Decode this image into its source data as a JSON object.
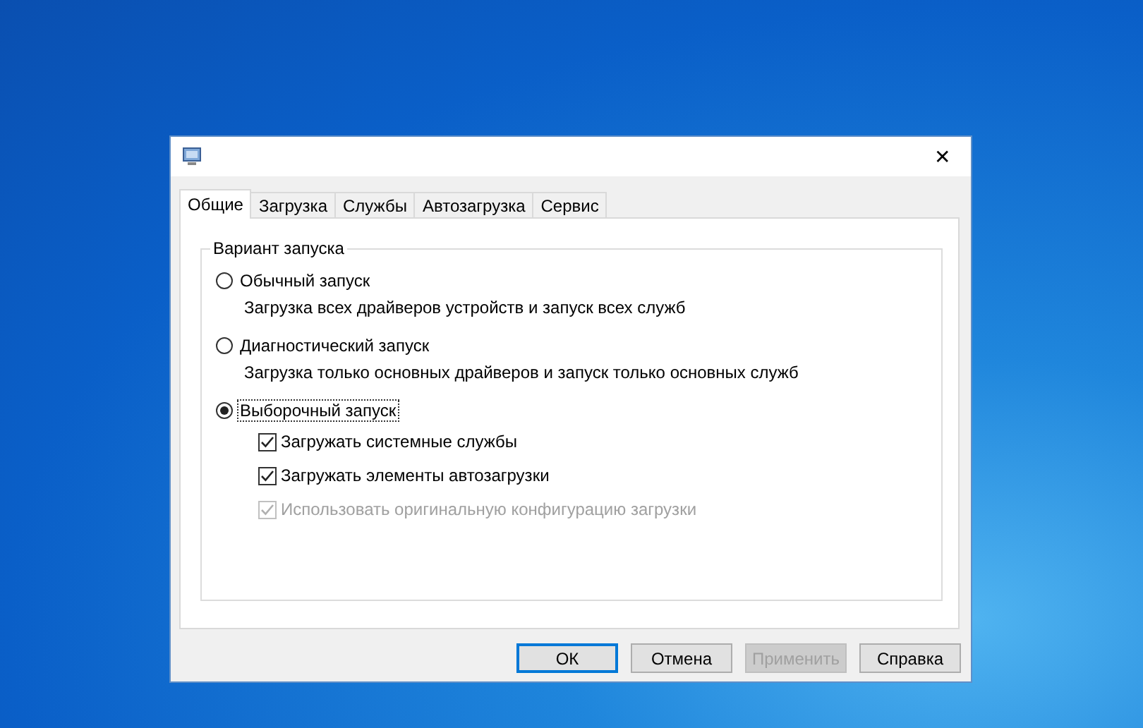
{
  "window": {
    "close": "✕"
  },
  "tabs": [
    {
      "label": "Общие",
      "selected": true
    },
    {
      "label": "Загрузка",
      "selected": false
    },
    {
      "label": "Службы",
      "selected": false
    },
    {
      "label": "Автозагрузка",
      "selected": false
    },
    {
      "label": "Сервис",
      "selected": false
    }
  ],
  "group": {
    "title": "Вариант запуска",
    "options": [
      {
        "label": "Обычный запуск",
        "description": "Загрузка всех драйверов устройств и запуск всех служб",
        "selected": false,
        "focused": false
      },
      {
        "label": "Диагностический запуск",
        "description": "Загрузка только основных драйверов и запуск только основных служб",
        "selected": false,
        "focused": false
      },
      {
        "label": "Выборочный запуск",
        "selected": true,
        "focused": true,
        "checkboxes": [
          {
            "label": "Загружать системные службы",
            "checked": true,
            "disabled": false
          },
          {
            "label": "Загружать элементы автозагрузки",
            "checked": true,
            "disabled": false
          },
          {
            "label": "Использовать оригинальную конфигурацию загрузки",
            "checked": true,
            "disabled": true
          }
        ]
      }
    ]
  },
  "buttons": [
    {
      "label": "ОК",
      "default": true,
      "disabled": false
    },
    {
      "label": "Отмена",
      "default": false,
      "disabled": false
    },
    {
      "label": "Применить",
      "default": false,
      "disabled": true
    },
    {
      "label": "Справка",
      "default": false,
      "disabled": false
    }
  ]
}
